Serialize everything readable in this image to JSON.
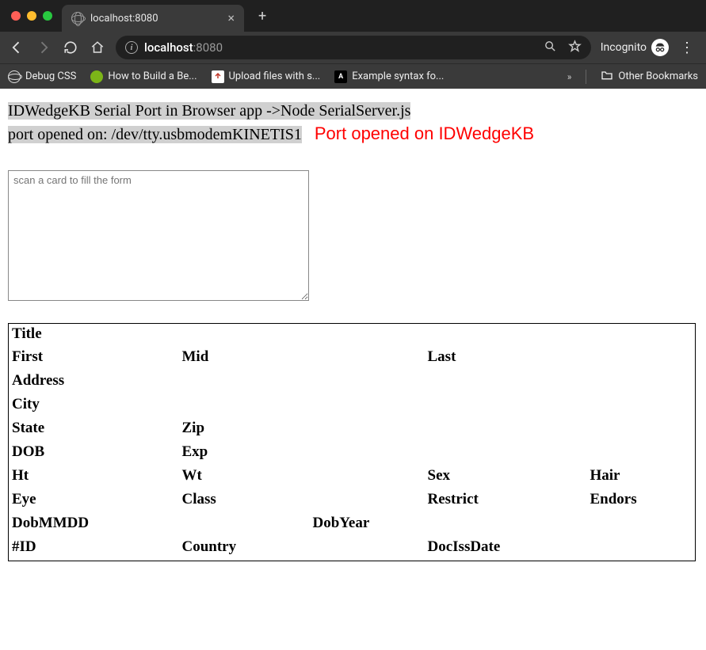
{
  "browser": {
    "tab_title": "localhost:8080",
    "url_host": "localhost",
    "url_port": ":8080",
    "incognito_label": "Incognito",
    "bookmarks": [
      {
        "label": "Debug CSS"
      },
      {
        "label": "How to Build a Be..."
      },
      {
        "label": "Upload files with s..."
      },
      {
        "label": "Example syntax fo..."
      }
    ],
    "other_bookmarks_label": "Other Bookmarks"
  },
  "page": {
    "header_line1": "IDWedgeKB Serial Port in Browser app ->Node SerialServer.js",
    "header_line2": "port opened on: /dev/tty.usbmodemKINETIS1",
    "port_message": "Port opened on IDWedgeKB",
    "textarea_placeholder": "scan a card to fill the form",
    "fields": {
      "title": "Title",
      "first": "First",
      "mid": "Mid",
      "last": "Last",
      "address": "Address",
      "city": "City",
      "state": "State",
      "zip": "Zip",
      "dob": "DOB",
      "exp": "Exp",
      "ht": "Ht",
      "wt": "Wt",
      "sex": "Sex",
      "hair": "Hair",
      "eye": "Eye",
      "class": "Class",
      "restrict": "Restrict",
      "endors": "Endors",
      "dobmmdd": "DobMMDD",
      "dobyear": "DobYear",
      "id": "#ID",
      "country": "Country",
      "docissdate": "DocIssDate"
    }
  }
}
